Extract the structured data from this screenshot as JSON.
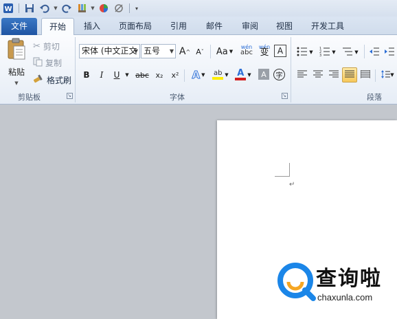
{
  "tabs": {
    "file": "文件",
    "home": "开始",
    "insert": "插入",
    "page_layout": "页面布局",
    "references": "引用",
    "mailings": "邮件",
    "review": "审阅",
    "view": "视图",
    "developer": "开发工具"
  },
  "clipboard": {
    "paste": "粘贴",
    "cut": "剪切",
    "copy": "复制",
    "format_painter": "格式刷",
    "group_label": "剪贴板"
  },
  "font": {
    "font_name": "宋体 (中文正文",
    "font_size": "五号",
    "group_label": "字体",
    "bold": "B",
    "italic": "I",
    "underline": "U",
    "strikethrough": "abc",
    "subscript": "x₂",
    "superscript": "x²",
    "change_case": "Aa",
    "grow_font": "A",
    "shrink_font": "A",
    "wen": "wén",
    "bian": "变",
    "char_border": "A",
    "font_color": "A",
    "char_shading": "A",
    "enclose": "字"
  },
  "paragraph": {
    "group_label": "段落"
  },
  "document": {
    "paragraph_mark": "↵"
  },
  "watermark": {
    "brand": "查询啦",
    "url": "chaxunla.com"
  },
  "colors": {
    "file_tab": "#2a62b3",
    "accent_blue": "#1b86e8",
    "font_color_red": "#d21e1e",
    "highlight_yellow": "#ffee00",
    "active_align": "#f6c85b"
  }
}
